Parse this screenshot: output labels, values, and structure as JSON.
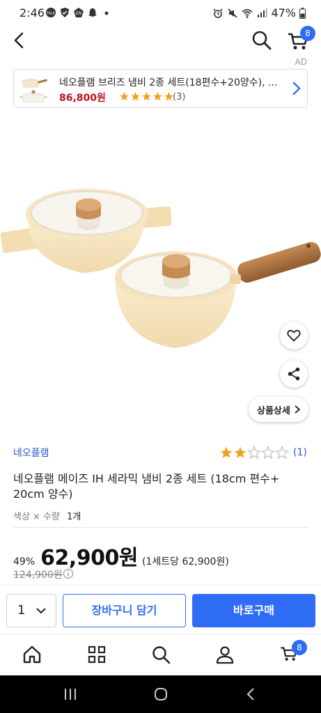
{
  "status_bar": {
    "time": "2:46",
    "battery": "47%",
    "left_icons": [
      "talk-icon",
      "shield-icon",
      "en-icon",
      "snapchat-icon",
      "dot-icon"
    ],
    "right_icons": [
      "alarm-icon",
      "mute-icon",
      "wifi-icon",
      "signal-icon",
      "battery-icon"
    ]
  },
  "header": {
    "cart_count": "8"
  },
  "ad": {
    "label": "AD",
    "title": "네오플램 브리즈 냄비 2종 세트(18편수+20양수), ...",
    "price": "86,800원",
    "rating_count": "(3)",
    "stars": 5
  },
  "detail_button": "상품상세",
  "product": {
    "brand": "네오플램",
    "rating_count": "(1)",
    "rating": 2,
    "title": "네오플램 메이즈 IH 세라믹 냄비 2종 세트 (18cm 편수+ 20cm 양수)",
    "option_label": "색상 × 수량",
    "option_qty": "1개",
    "discount": "49%",
    "price": "62,900원",
    "unit_price": "(1세트당 62,900원)",
    "original_price": "124,900원"
  },
  "buy_bar": {
    "quantity": "1",
    "add_to_cart": "장바구니 담기",
    "buy_now": "바로구매"
  },
  "bottom_nav": {
    "items": [
      "home-icon",
      "category-icon",
      "search-icon",
      "user-icon",
      "cart-icon"
    ],
    "cart_count": "8"
  },
  "colors": {
    "accent": "#2f6cf6",
    "brand_link": "#2a58d4",
    "ad_price": "#c0101d",
    "star": "#f3a31b"
  }
}
